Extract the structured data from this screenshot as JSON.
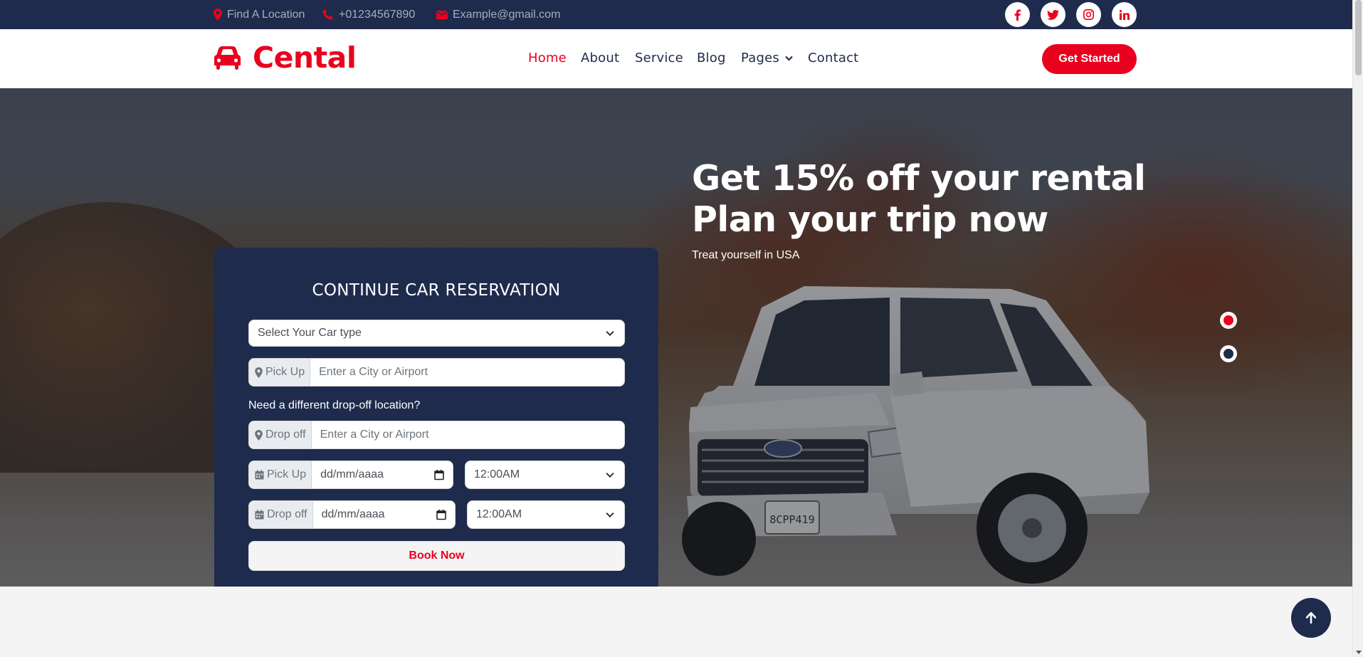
{
  "topbar": {
    "location": "Find A Location",
    "phone": "+01234567890",
    "email": "Example@gmail.com",
    "social": [
      "facebook-icon",
      "twitter-icon",
      "instagram-icon",
      "linkedin-icon"
    ]
  },
  "brand": {
    "name": "Cental"
  },
  "nav": {
    "home": "Home",
    "about": "About",
    "service": "Service",
    "blog": "Blog",
    "pages": "Pages",
    "contact": "Contact",
    "cta": "Get Started"
  },
  "reservation": {
    "title": "CONTINUE CAR RESERVATION",
    "car_type_placeholder": "Select Your Car type",
    "pickup_addon": "Pick Up",
    "pickup_placeholder": "Enter a City or Airport",
    "drop_question": "Need a different drop-off location?",
    "dropoff_addon": "Drop off",
    "dropoff_placeholder": "Enter a City or Airport",
    "pickup_date_addon": "Pick Up",
    "pickup_date": "dd/mm/aaaa",
    "pickup_time": "12:00AM",
    "dropoff_date_addon": "Drop off",
    "dropoff_date": "dd/mm/aaaa",
    "dropoff_time": "12:00AM",
    "book_button": "Book Now"
  },
  "hero": {
    "title_line1": "Get 15% off your rental",
    "title_line2": "Plan your trip now",
    "subtitle": "Treat yourself in USA"
  },
  "colors": {
    "navy": "#1f2b4d",
    "accent": "#ea001e",
    "muted": "#a7adbd"
  }
}
